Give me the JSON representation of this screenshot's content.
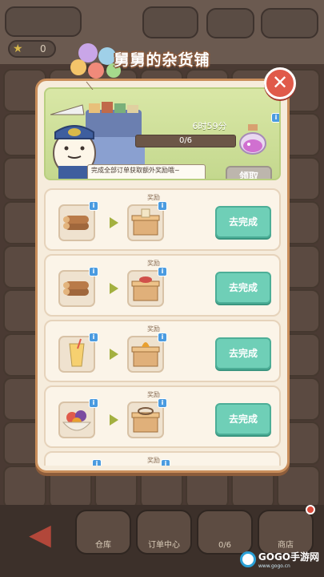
{
  "popup": {
    "title": "舅舅的杂货铺",
    "close_icon": "close-icon"
  },
  "banner": {
    "timer": "6时59分",
    "progress_text": "0/6",
    "progress_value": 0,
    "progress_max": 6,
    "note": "完成全部订单获取额外奖励哦~",
    "claim_label": "领取",
    "reward_icon": "potion-jar-icon"
  },
  "tasks": [
    {
      "reward_label": "奖励",
      "action_label": "去完成",
      "item_icon": "wood-logs-icon",
      "reward_icon": "gift-box-icon"
    },
    {
      "reward_label": "奖励",
      "action_label": "去完成",
      "item_icon": "wood-logs-icon",
      "reward_icon": "gift-box-icon"
    },
    {
      "reward_label": "奖励",
      "action_label": "去完成",
      "item_icon": "juice-glass-icon",
      "reward_icon": "gift-box-icon"
    },
    {
      "reward_label": "奖励",
      "action_label": "去完成",
      "item_icon": "fruit-bowl-icon",
      "reward_icon": "gift-box-icon"
    },
    {
      "reward_label": "奖励"
    }
  ],
  "background": {
    "top_counter": "0",
    "bottom_labels": [
      "仓库",
      "订单中心",
      "0/6",
      "商店"
    ],
    "watermark": "GOGO手游网",
    "watermark_url": "www.gogo.cn"
  },
  "colors": {
    "accent_green": "#6fcfb7",
    "close_red": "#e05a4a",
    "popup_bg": "#f6ecdc",
    "progress_fill": "#e1a543"
  }
}
